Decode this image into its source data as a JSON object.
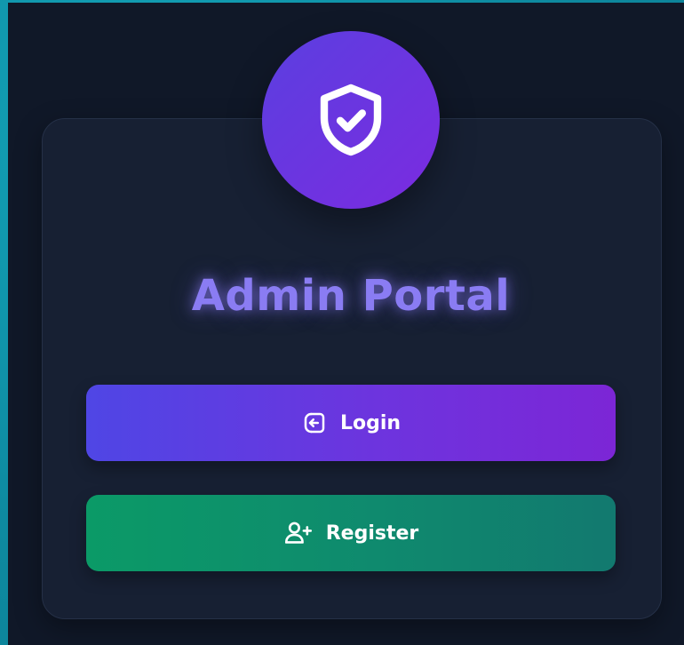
{
  "portal": {
    "title": "Admin Portal",
    "badge_icon": "shield-check-icon"
  },
  "actions": {
    "login_label": "Login",
    "login_icon": "login-icon",
    "register_label": "Register",
    "register_icon": "user-plus-icon"
  },
  "colors": {
    "background": "#101828",
    "card": "#172033",
    "frame": "#0e8aa0",
    "title": "#8a7cf3",
    "login_start": "#4f46e5",
    "login_end": "#7c26d6",
    "register_start": "#0b9a67",
    "register_end": "#12796f"
  }
}
